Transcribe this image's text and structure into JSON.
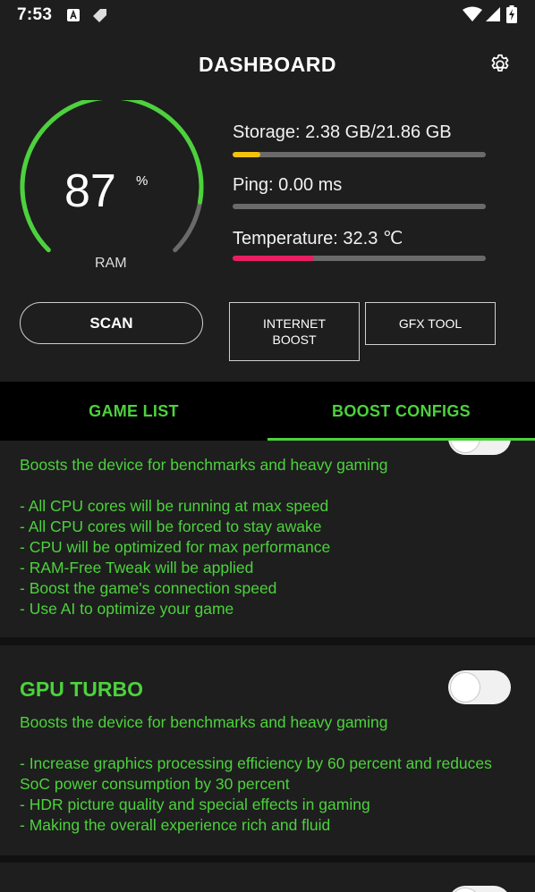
{
  "status_bar": {
    "time": "7:53",
    "icons": [
      "notification-a-icon",
      "tag-icon",
      "wifi-icon",
      "signal-icon",
      "battery-charging-icon"
    ]
  },
  "header": {
    "title": "DASHBOARD",
    "settings_icon": "gear-icon"
  },
  "gauge": {
    "value": "87",
    "unit": "%",
    "label": "RAM",
    "fraction": 0.87,
    "accent_color": "#4cd23c",
    "track_color": "#6a6a6a"
  },
  "stats": {
    "storage": {
      "text": "Storage: 2.38 GB/21.86 GB",
      "fraction": 0.109,
      "color": "#f4c20d"
    },
    "ping": {
      "text": "Ping: 0.00 ms",
      "fraction": 0.0,
      "color": "#4cd23c"
    },
    "temperature": {
      "text": "Temperature: 32.3 ℃",
      "fraction": 0.323,
      "color": "#e91e63"
    }
  },
  "buttons": {
    "scan": "SCAN",
    "internet_boost_line1": "INTERNET",
    "internet_boost_line2": "BOOST",
    "gfx_tool": "GFX TOOL"
  },
  "tabs": [
    {
      "label": "GAME LIST",
      "selected": false
    },
    {
      "label": "BOOST CONFIGS",
      "selected": true
    }
  ],
  "cards": [
    {
      "subtitle": "Boosts the device for benchmarks and heavy gaming",
      "lines": [
        "- All CPU cores will be running at max speed",
        "- All CPU cores will be forced to stay awake",
        "- CPU will be optimized for max performance",
        "- RAM-Free Tweak will be applied",
        "- Boost the game's connection speed",
        "- Use AI to optimize your game"
      ],
      "toggle_on": false
    },
    {
      "title": "GPU TURBO",
      "subtitle": "Boosts the device for benchmarks and heavy gaming",
      "lines": [
        "- Increase graphics processing efficiency by 60 percent and reduces SoC power consumption by 30 percent",
        "- HDR picture quality and special effects in gaming",
        "- Making the overall experience rich and fluid"
      ],
      "toggle_on": false
    }
  ],
  "theme": {
    "accent": "#4cd23c",
    "background": "#1e1e1e",
    "tab_background": "#000000"
  }
}
